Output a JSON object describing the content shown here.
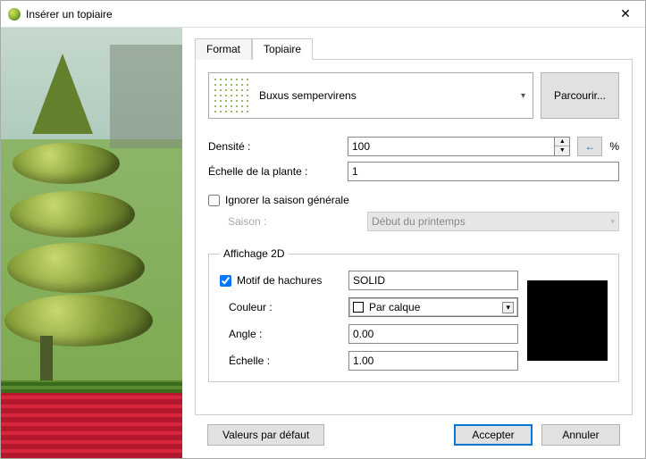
{
  "window": {
    "title": "Insérer un topiaire"
  },
  "tabs": {
    "format": "Format",
    "topiary": "Topiaire"
  },
  "plant": {
    "name": "Buxus sempervirens",
    "browse": "Parcourir..."
  },
  "density": {
    "label": "Densité :",
    "value": "100",
    "unit": "%"
  },
  "scale": {
    "label": "Échelle de la plante :",
    "value": "1"
  },
  "season_ignore": {
    "label": "Ignorer la saison générale"
  },
  "season": {
    "label": "Saison :",
    "value": "Début du printemps"
  },
  "display2d": {
    "legend": "Affichage 2D",
    "hatch_label": "Motif de hachures",
    "hatch_value": "SOLID",
    "color_label": "Couleur :",
    "color_value": "Par calque",
    "angle_label": "Angle :",
    "angle_value": "0.00",
    "scale_label": "Échelle :",
    "scale_value": "1.00"
  },
  "footer": {
    "defaults": "Valeurs par défaut",
    "accept": "Accepter",
    "cancel": "Annuler"
  }
}
